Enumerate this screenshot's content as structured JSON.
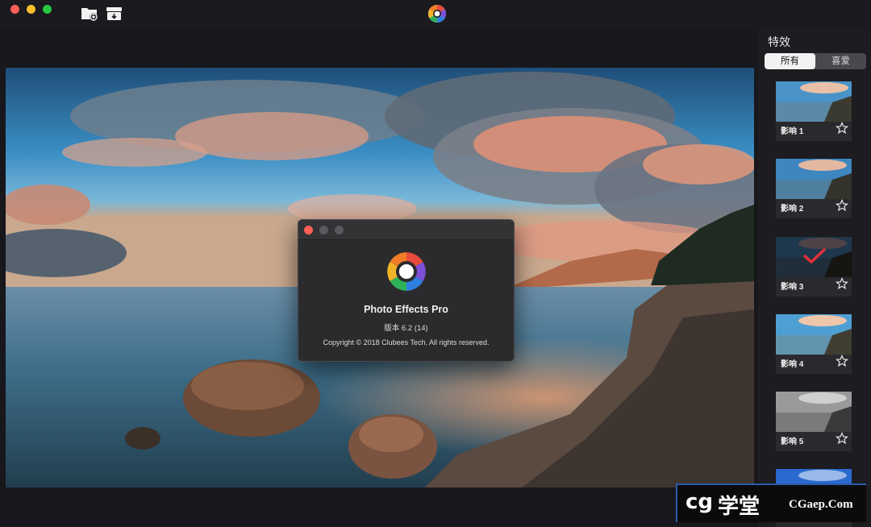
{
  "window": {
    "close_color": "#ff5f57",
    "minimize_color": "#febc2e",
    "zoom_color": "#28c840",
    "toolbar_icons": [
      "folder-add-icon",
      "archive-icon"
    ],
    "app_icon": "photo-effects-logo-icon"
  },
  "about_dialog": {
    "app_name": "Photo Effects Pro",
    "version": "版本 6.2 (14)",
    "copyright": "Copyright © 2018 Clubees Tech. All rights reserved."
  },
  "sidebar": {
    "title": "特效",
    "tabs": [
      {
        "label": "所有",
        "active": true
      },
      {
        "label": "喜爱",
        "active": false
      }
    ],
    "effects": [
      {
        "label": "影响 1",
        "selected": false,
        "style": "color"
      },
      {
        "label": "影响 2",
        "selected": false,
        "style": "color"
      },
      {
        "label": "影响 3",
        "selected": true,
        "style": "dark"
      },
      {
        "label": "影响 4",
        "selected": false,
        "style": "color"
      },
      {
        "label": "影响 5",
        "selected": false,
        "style": "mono"
      }
    ]
  },
  "watermark": {
    "logo": "cg",
    "cn": "学堂",
    "url": "CGaep.Com"
  }
}
